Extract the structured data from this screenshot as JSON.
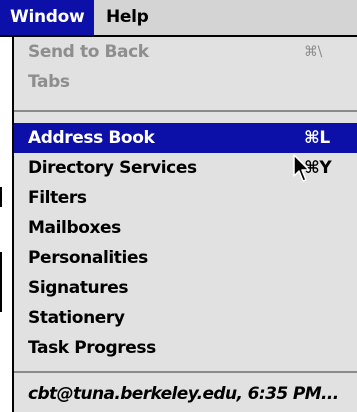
{
  "menubar": {
    "items": [
      {
        "label": "Window"
      },
      {
        "label": "Help"
      }
    ]
  },
  "menu": {
    "disabled_items": [
      {
        "label": "Send to Back",
        "shortcut": "⌘\\"
      },
      {
        "label": "Tabs",
        "shortcut": ""
      }
    ],
    "items": [
      {
        "label": "Address Book",
        "shortcut": "⌘L"
      },
      {
        "label": "Directory Services",
        "shortcut": "⌘Y"
      },
      {
        "label": "Filters",
        "shortcut": ""
      },
      {
        "label": "Mailboxes",
        "shortcut": ""
      },
      {
        "label": "Personalities",
        "shortcut": ""
      },
      {
        "label": "Signatures",
        "shortcut": ""
      },
      {
        "label": "Stationery",
        "shortcut": ""
      },
      {
        "label": "Task Progress",
        "shortcut": ""
      }
    ],
    "open_windows": [
      {
        "label": "cbt@tuna.berkeley.edu, 6:35 PM..."
      }
    ]
  },
  "colors": {
    "highlight": "#0c10a8",
    "menu_bg": "#e1e1e1",
    "disabled_text": "#8e8e8e"
  },
  "cursor_icon": "arrow-cursor-icon"
}
